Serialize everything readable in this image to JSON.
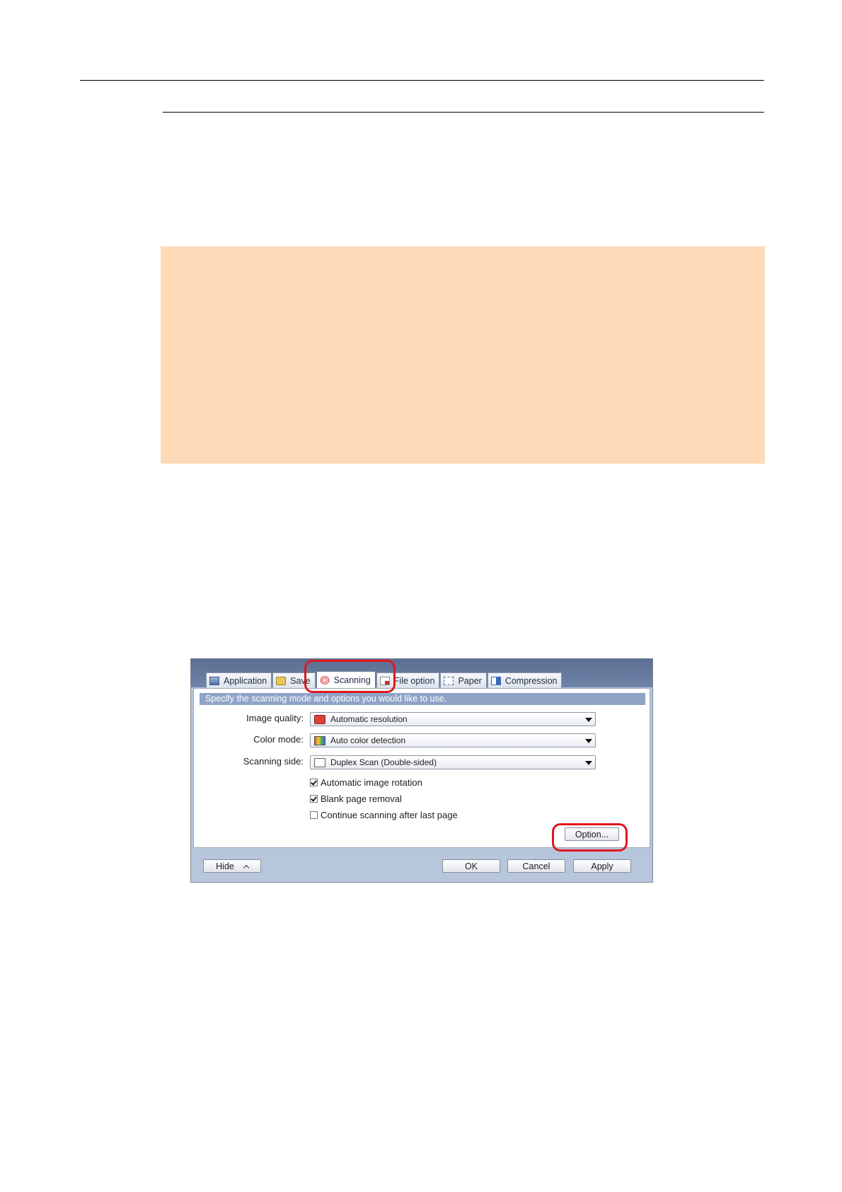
{
  "dialog": {
    "tabs": [
      {
        "label": "Application",
        "icon": "application-icon"
      },
      {
        "label": "Save",
        "icon": "save-folder-icon"
      },
      {
        "label": "Scanning",
        "icon": "scanning-icon",
        "active": true
      },
      {
        "label": "File option",
        "icon": "pdf-file-icon"
      },
      {
        "label": "Paper",
        "icon": "paper-icon"
      },
      {
        "label": "Compression",
        "icon": "compression-icon"
      }
    ],
    "description": "Specify the scanning mode and options you would like to use.",
    "fields": {
      "image_quality": {
        "label": "Image quality:",
        "value": "Automatic resolution"
      },
      "color_mode": {
        "label": "Color mode:",
        "value": "Auto color detection"
      },
      "scanning_side": {
        "label": "Scanning side:",
        "value": "Duplex Scan (Double-sided)"
      }
    },
    "checkboxes": [
      {
        "label": "Automatic image rotation",
        "checked": true
      },
      {
        "label": "Blank page removal",
        "checked": true
      },
      {
        "label": "Continue scanning after last page",
        "checked": false
      }
    ],
    "buttons": {
      "option": "Option...",
      "hide": "Hide",
      "ok": "OK",
      "cancel": "Cancel",
      "apply": "Apply"
    },
    "callout_color": "#e0171f"
  }
}
